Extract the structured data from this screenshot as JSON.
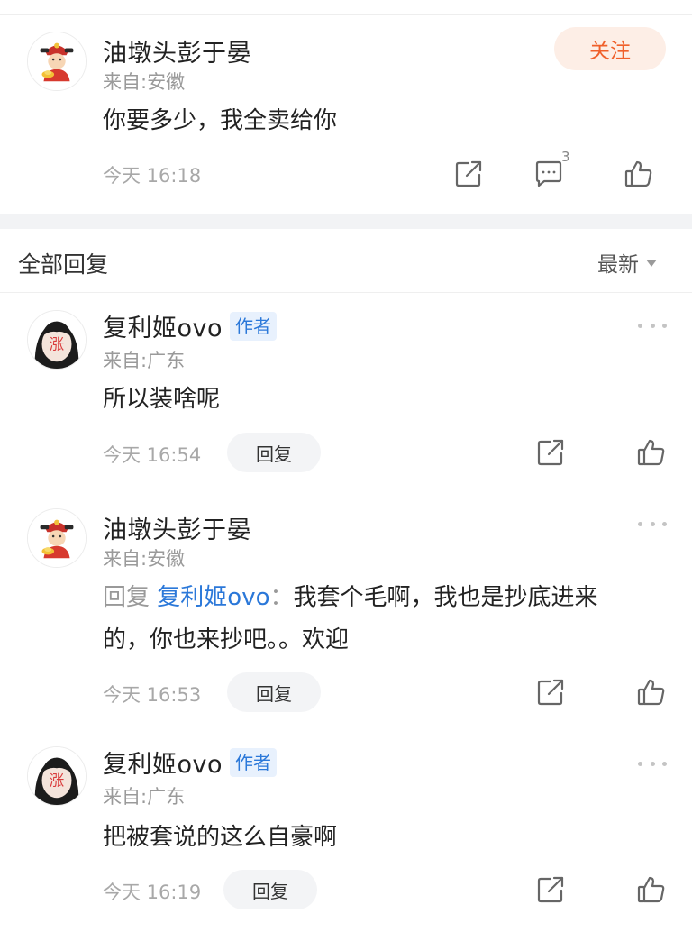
{
  "post": {
    "author": "油墩头彭于晏",
    "from": "来自:安徽",
    "follow_label": "关注",
    "text": "你要多少，我全卖给你",
    "time": "今天 16:18",
    "comment_count": "3"
  },
  "replies_header": {
    "title": "全部回复",
    "sort_label": "最新"
  },
  "replies": [
    {
      "author": "复利姬ovo",
      "author_badge": "作者",
      "from": "来自:广东",
      "text": "所以装啥呢",
      "time": "今天 16:54",
      "reply_label": "回复"
    },
    {
      "author": "油墩头彭于晏",
      "from": "来自:安徽",
      "reply_prefix": "回复",
      "reply_target": "复利姬ovo",
      "reply_colon": "：",
      "text_line1": "我套个毛啊，我也是抄底进来",
      "text_line2": "的，你也来抄吧。。欢迎",
      "time": "今天 16:53",
      "reply_label": "回复"
    },
    {
      "author": "复利姬ovo",
      "author_badge": "作者",
      "from": "来自:广东",
      "text": "把被套说的这么自豪啊",
      "time": "今天 16:19",
      "reply_label": "回复"
    }
  ],
  "avatar_girl_text": "涨",
  "colors": {
    "accent_orange": "#f0602b",
    "follow_bg": "#fdeee6",
    "link_blue": "#2b78d9",
    "badge_bg": "#e8f1fd",
    "muted_gray": "#a8a8a8"
  },
  "icons": {
    "share": "share-icon",
    "comment": "comment-icon",
    "like": "thumbs-up-icon",
    "more": "more-dots-icon",
    "sort_caret": "caret-down-icon"
  }
}
